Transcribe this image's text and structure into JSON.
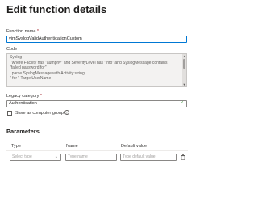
{
  "title": "Edit function details",
  "function_name": {
    "label": "Function name",
    "required_mark": "*",
    "value": "vimSyslogValidAuthenticationCustom"
  },
  "code": {
    "label": "Code",
    "lines": [
      "Syslog",
      "| where  Facility has \"authpriv\" and SeverityLevel has \"info\" and SyslogMessage contains",
      "\"failed password for\"",
      "| parse SyslogMessage with Activity:string",
      "\" for \" TargetUserName"
    ]
  },
  "legacy_category": {
    "label": "Legacy category",
    "required_mark": "*",
    "value": "Authentication"
  },
  "save_as_computer_group": {
    "label": "Save as computer group",
    "checked": false
  },
  "parameters": {
    "heading": "Parameters",
    "columns": {
      "type": "Type",
      "name": "Name",
      "default": "Default value"
    },
    "row": {
      "type_placeholder": "Select type",
      "name_placeholder": "Type name",
      "default_placeholder": "Type default value"
    }
  },
  "colors": {
    "accent": "#0078d4",
    "required": "#a4262c",
    "success": "#107c10"
  },
  "icons": [
    "checkmark-icon",
    "info-icon",
    "chevron-down-icon",
    "trash-icon",
    "scroll-up-icon",
    "scroll-down-icon"
  ]
}
